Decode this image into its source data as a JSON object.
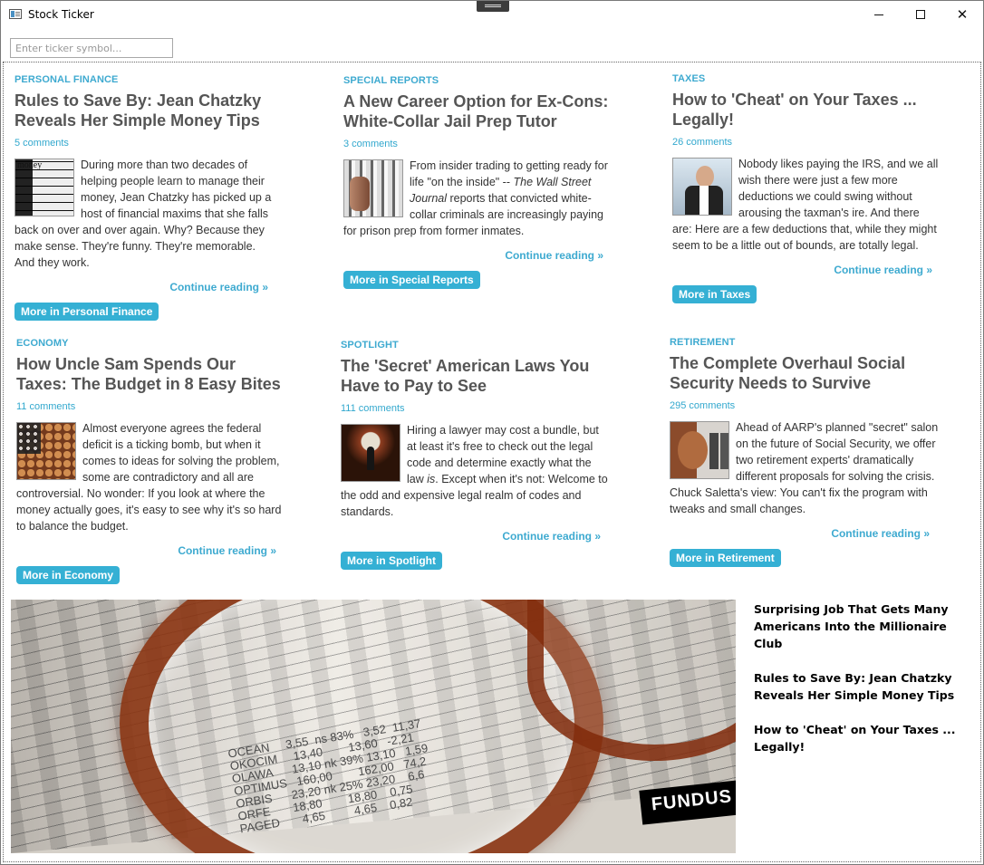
{
  "window": {
    "title": "Stock Ticker"
  },
  "search": {
    "placeholder": "Enter ticker symbol..."
  },
  "articles": [
    {
      "category": "Personal Finance",
      "title": "Rules to Save By: Jean Chatzky Reveals Her Simple Money Tips",
      "comments": "5 comments",
      "body": "During more than two decades of helping people learn to manage their money, Jean Chatzky has picked up a host of financial maxims that she falls back on over and over again. Why? Because they make sense. They're funny. They're memorable. And they work.",
      "continue": "Continue reading »",
      "more": "More in Personal Finance",
      "thumb_icon": "dictionary-money-image"
    },
    {
      "category": "Special Reports",
      "title": "A New Career Option for Ex-Cons: White-Collar Jail Prep Tutor",
      "comments": "3 comments",
      "body_prefix": "From insider trading to getting ready for life \"on the inside\" -- ",
      "body_italic": "The Wall Street Journal",
      "body_suffix": " reports that convicted white-collar criminals are increasingly paying for prison prep from former inmates.",
      "continue": "Continue reading »",
      "more": "More in Special Reports",
      "thumb_icon": "prison-bars-image"
    },
    {
      "category": "Taxes",
      "title": "How to 'Cheat' on Your Taxes ... Legally!",
      "comments": "26 comments",
      "body": "Nobody likes paying the IRS, and we all wish there were just a few more deductions we could swing without arousing the taxman's ire. And there are: Here are a few deductions that, while they might seem to be a little out of bounds, are totally legal.",
      "continue": "Continue reading »",
      "more": "More in Taxes",
      "thumb_icon": "businessman-image"
    },
    {
      "category": "Economy",
      "title": "How Uncle Sam Spends Our Taxes: The Budget in 8 Easy Bites",
      "comments": "11 comments",
      "body": "Almost everyone agrees the federal deficit is a ticking bomb, but when it comes to ideas for solving the problem, some are contradictory and all are controversial. No wonder: If you look at where the money actually goes, it's easy to see why it's so hard to balance the budget.",
      "continue": "Continue reading »",
      "more": "More in Economy",
      "thumb_icon": "coin-flag-image"
    },
    {
      "category": "Spotlight",
      "title": "The 'Secret' American Laws You Have to Pay to See",
      "comments": "111 comments",
      "body_prefix": "Hiring a lawyer may cost a bundle, but at least it's free to check out the legal code and determine exactly what the law ",
      "body_italic": "is",
      "body_suffix": ". Except when it's not: Welcome to the odd and expensive legal realm of codes and standards.",
      "continue": "Continue reading »",
      "more": "More in Spotlight",
      "thumb_icon": "keyhole-image"
    },
    {
      "category": "Retirement",
      "title": "The Complete Overhaul Social Security Needs to Survive",
      "comments": "295 comments",
      "body": "Ahead of AARP's planned \"secret\" salon on the future of Social Security, we offer two retirement experts' dramatically different proposals for solving the crisis. Chuck Saletta's view: You can't fix the program with tweaks and small changes.",
      "continue": "Continue reading »",
      "more": "More in Retirement",
      "thumb_icon": "phone-call-image"
    }
  ],
  "feature": {
    "fund_label": "FUNDUS",
    "image_icon": "glasses-newspaper-image"
  },
  "sidebar": {
    "links": [
      "Surprising Job That Gets Many Americans Into the Millionaire Club",
      "Rules to Save By: Jean Chatzky Reveals Her Simple Money Tips",
      "How to 'Cheat' on Your Taxes ... Legally!"
    ]
  }
}
